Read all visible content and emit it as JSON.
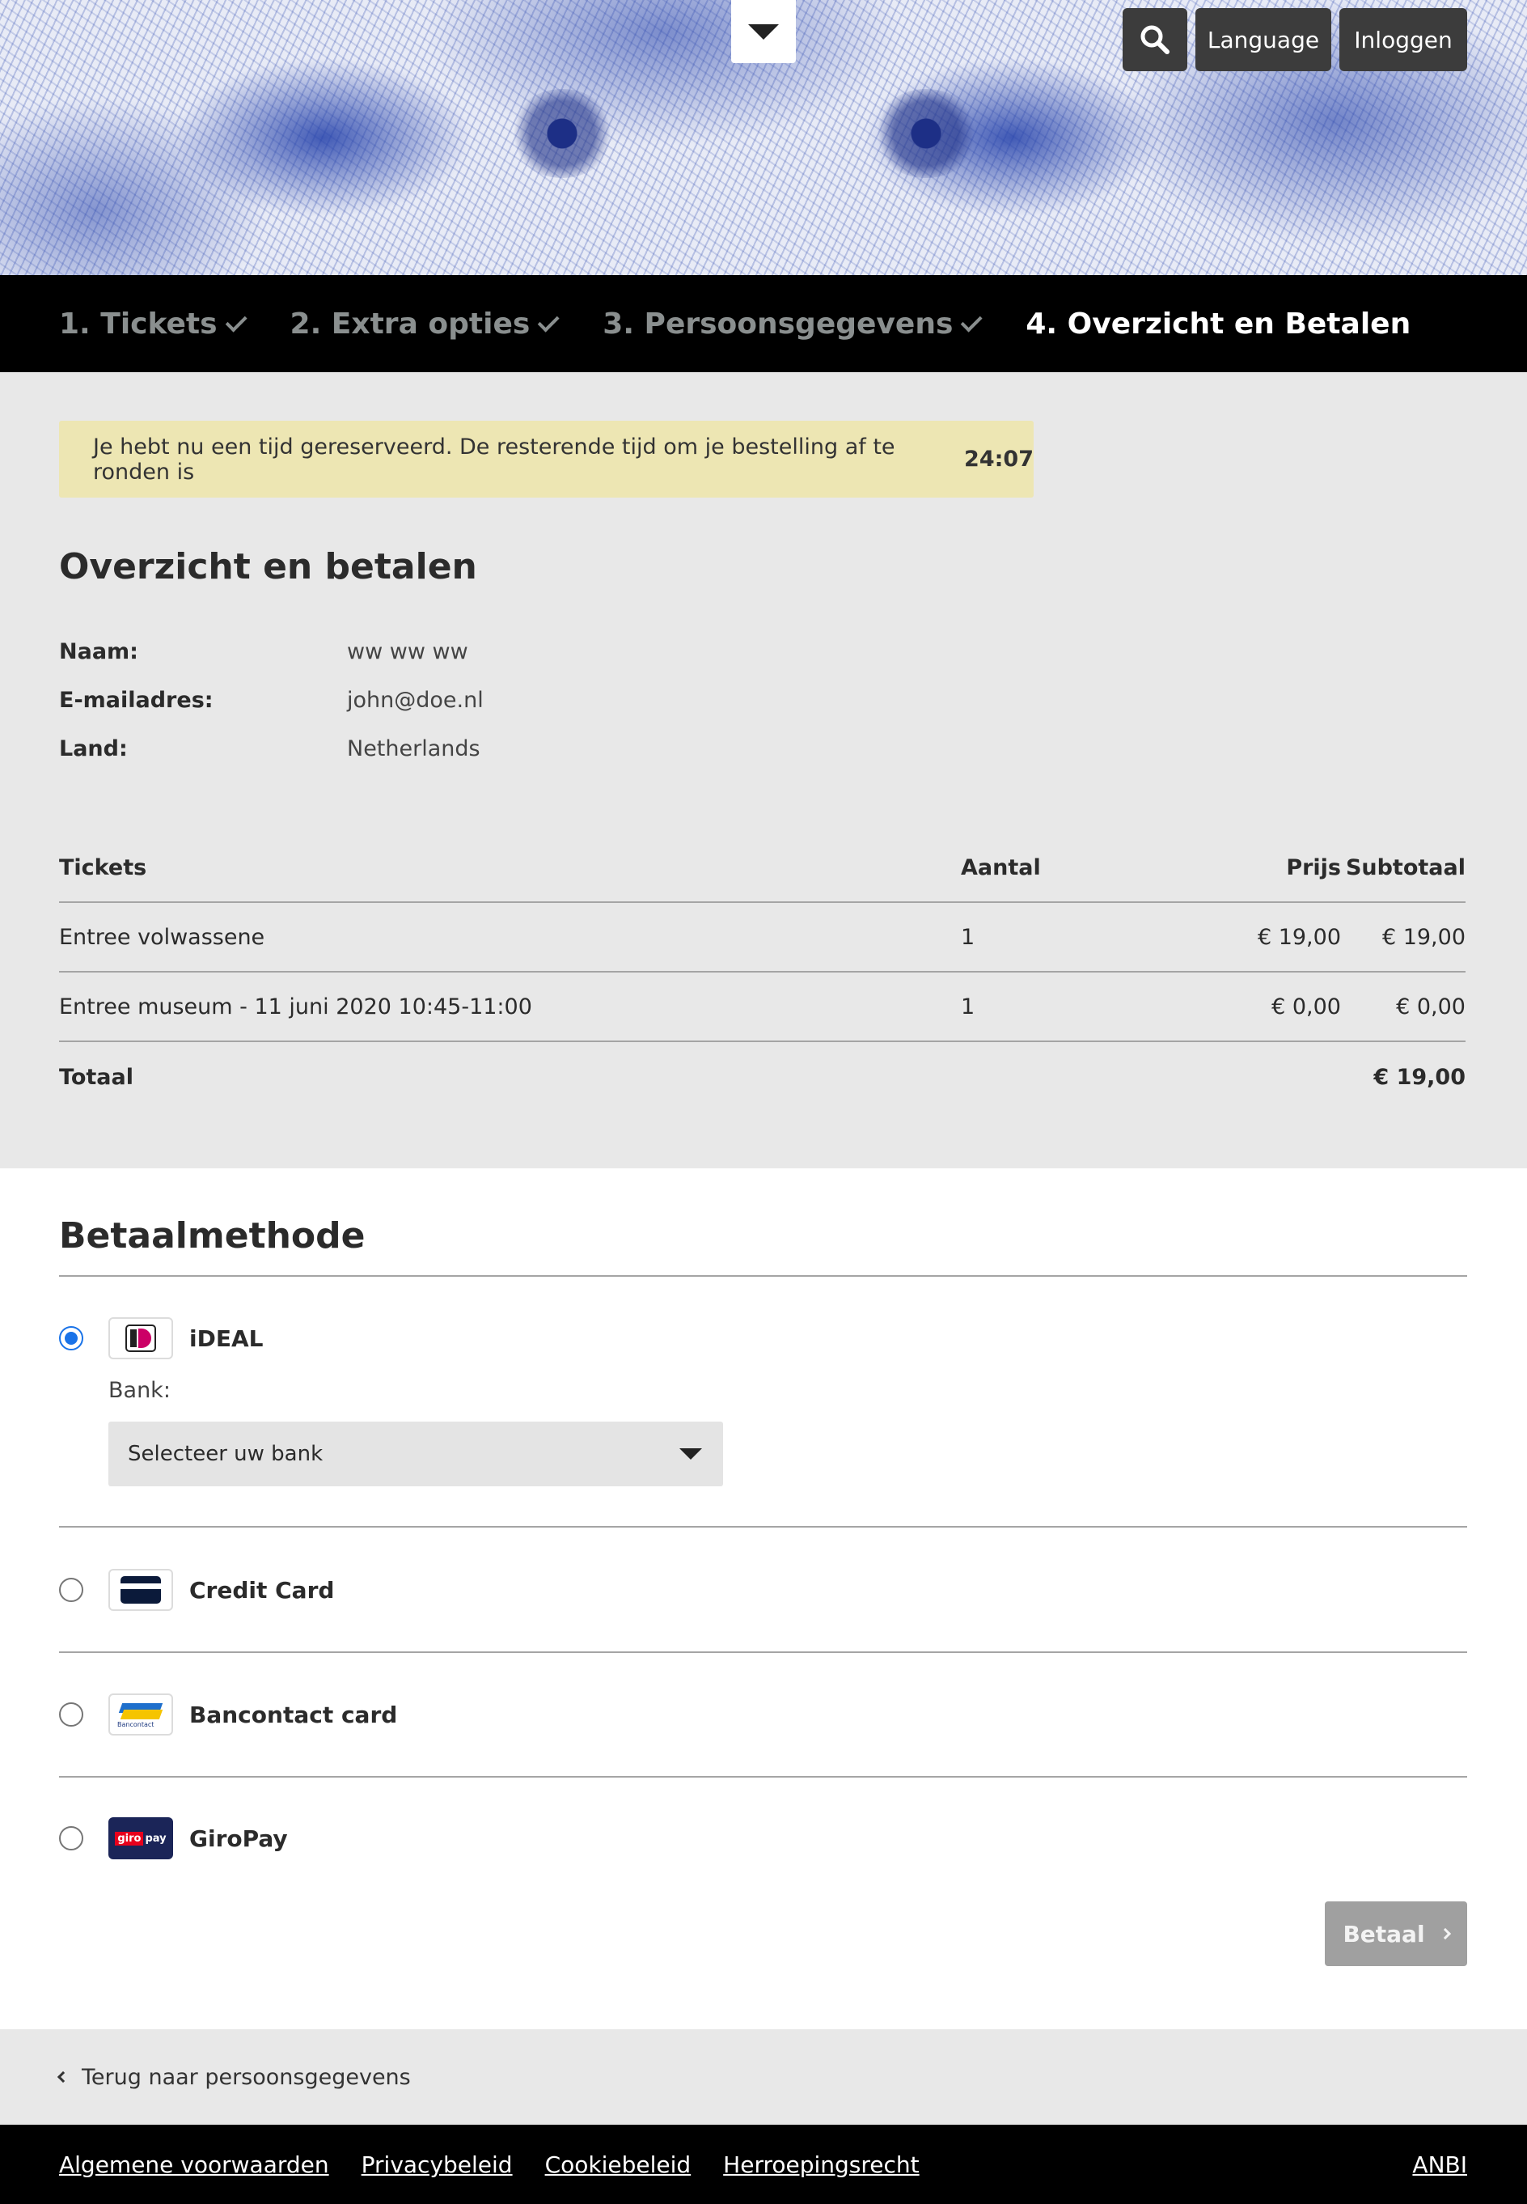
{
  "header": {
    "language_label": "Language",
    "login_label": "Inloggen"
  },
  "steps": [
    {
      "label": "1. Tickets",
      "done": true
    },
    {
      "label": "2. Extra opties",
      "done": true
    },
    {
      "label": "3. Persoonsgegevens",
      "done": true
    },
    {
      "label": "4. Overzicht en Betalen",
      "done": false
    }
  ],
  "notice": {
    "text": "Je hebt nu een tijd gereserveerd. De resterende tijd om je bestelling af te ronden is",
    "time": "24:07"
  },
  "summary": {
    "title": "Overzicht en betalen",
    "fields": [
      {
        "label": "Naam:",
        "value": "ww ww ww"
      },
      {
        "label": "E-mailadres:",
        "value": "john@doe.nl"
      },
      {
        "label": "Land:",
        "value": "Netherlands"
      }
    ]
  },
  "tickets_table": {
    "headers": [
      "Tickets",
      "Aantal",
      "Prijs",
      "Subtotaal"
    ],
    "rows": [
      [
        "Entree volwassene",
        "1",
        "€ 19,00",
        "€ 19,00"
      ],
      [
        "Entree museum - 11 juni 2020 10:45-11:00",
        "1",
        "€ 0,00",
        "€ 0,00"
      ]
    ],
    "total_label": "Totaal",
    "total_value": "€ 19,00"
  },
  "payment": {
    "title": "Betaalmethode",
    "methods": [
      {
        "label": "iDEAL",
        "icon": "ideal-icon",
        "selected": true
      },
      {
        "label": "Credit Card",
        "icon": "credit-card-icon",
        "selected": false
      },
      {
        "label": "Bancontact card",
        "icon": "bancontact-icon",
        "selected": false
      },
      {
        "label": "GiroPay",
        "icon": "giropay-icon",
        "selected": false
      }
    ],
    "bank_label": "Bank:",
    "bank_select_value": "Selecteer uw bank",
    "bancontact_logo_text": "Bancontact",
    "giropay_logo": {
      "part1": "giro",
      "part2": "pay"
    },
    "pay_button": "Betaal"
  },
  "back_link": "Terug naar persoonsgegevens",
  "footer": {
    "links": [
      "Algemene voorwaarden",
      "Privacybeleid",
      "Cookiebeleid",
      "Herroepingsrecht"
    ],
    "anbi": "ANBI"
  },
  "colors": {
    "hero_blue": "#2340aa",
    "notice_bg": "#ede6b3",
    "radio_selected": "#1a73e8",
    "step_active": "#ffffff",
    "step_done": "#8a8f8f"
  }
}
